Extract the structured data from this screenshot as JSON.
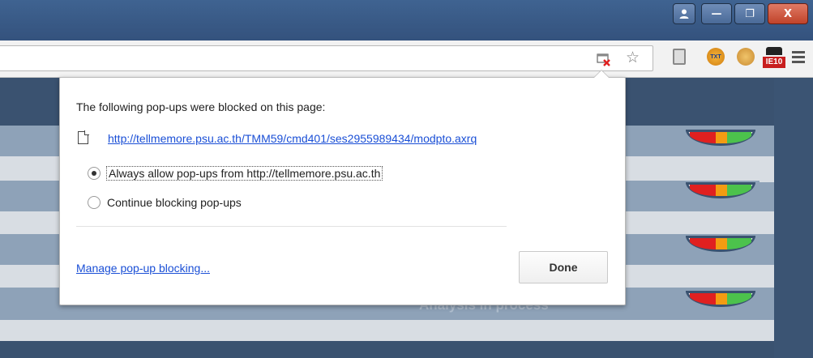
{
  "titlebar": {
    "buttons": {
      "user": "",
      "minimize": "—",
      "maximize": "❐",
      "close": "X"
    }
  },
  "toolbar": {
    "extensions": {
      "txt_label": "TXT",
      "ie_label": "IE10"
    }
  },
  "background": {
    "status_text": "Analysis in process"
  },
  "popup_bubble": {
    "heading": "The following pop-ups were blocked on this page:",
    "blocked_url": "http://tellmemore.psu.ac.th/TMM59/cmd401/ses2955989434/modpto.axrq",
    "options": [
      {
        "label": "Always allow pop-ups from http://tellmemore.psu.ac.th",
        "checked": true
      },
      {
        "label": "Continue blocking pop-ups",
        "checked": false
      }
    ],
    "manage_link": "Manage pop-up blocking...",
    "done_label": "Done"
  },
  "colors": {
    "titlebar": "#3f6391",
    "link": "#1a4fd6",
    "page_dark": "#3a5270",
    "page_stripe_light": "#d8dde3",
    "page_stripe_mid": "#8ea2b8"
  },
  "icons": {
    "popup_blocked": "popup-blocked-icon",
    "bookmark": "star-icon",
    "menu": "hamburger-menu-icon",
    "document": "document-icon"
  }
}
